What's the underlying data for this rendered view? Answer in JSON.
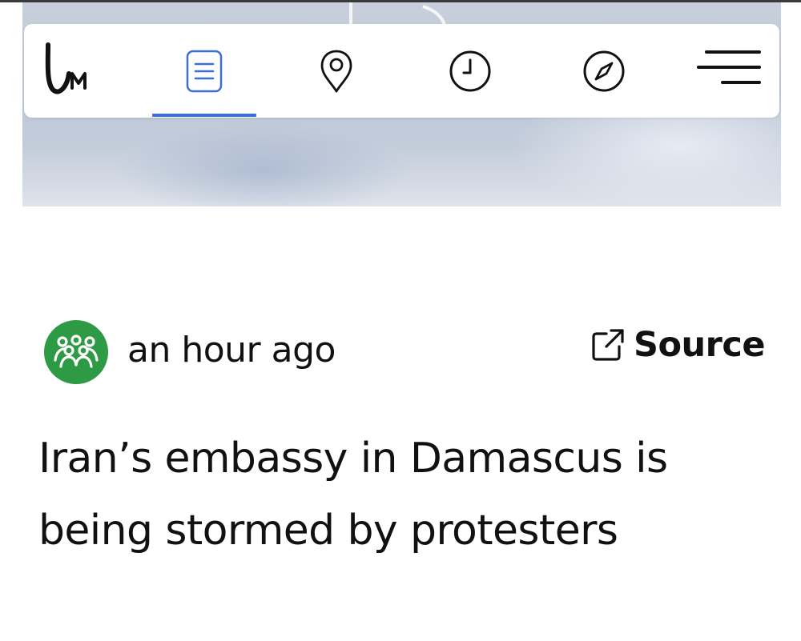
{
  "app": {
    "logo_text": "LM"
  },
  "nav": {
    "items": [
      {
        "name": "feed",
        "icon": "document-list-icon",
        "active": true
      },
      {
        "name": "map",
        "icon": "map-pin-icon",
        "active": false
      },
      {
        "name": "timeline",
        "icon": "clock-icon",
        "active": false
      },
      {
        "name": "explore",
        "icon": "compass-icon",
        "active": false
      }
    ],
    "menu_icon": "hamburger-menu-icon",
    "active_color": "#3b6fd8"
  },
  "post": {
    "avatar_icon": "group-people-icon",
    "avatar_color": "#2f9a45",
    "time": "an hour ago",
    "source_label": "Source",
    "source_icon": "external-link-icon",
    "headline": "Iran’s embassy in Damascus is being stormed by protesters"
  }
}
